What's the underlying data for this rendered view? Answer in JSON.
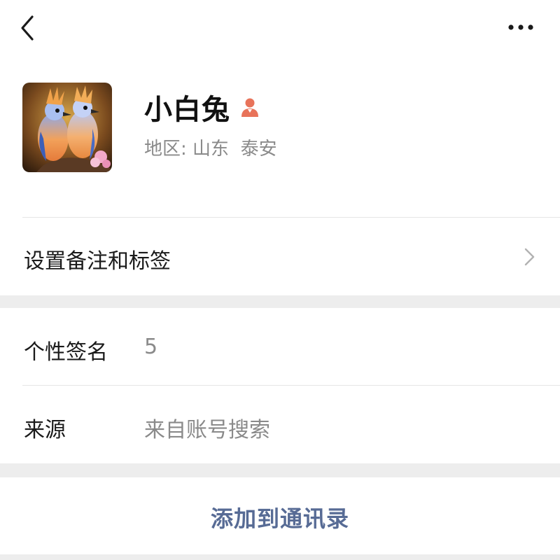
{
  "profile": {
    "name": "小白兔",
    "region_label": "地区:",
    "region_province": "山东",
    "region_city": "泰安",
    "gender_icon": "female-user-icon"
  },
  "actions": {
    "remark_label": "设置备注和标签",
    "add_contact_label": "添加到通讯录"
  },
  "info": {
    "signature_key": "个性签名",
    "signature_value": "5",
    "source_key": "来源",
    "source_value": "来自账号搜索"
  },
  "colors": {
    "link": "#576b95",
    "gender_icon": "#e8735a",
    "muted_text": "#8a8a8a",
    "background": "#ededed"
  }
}
